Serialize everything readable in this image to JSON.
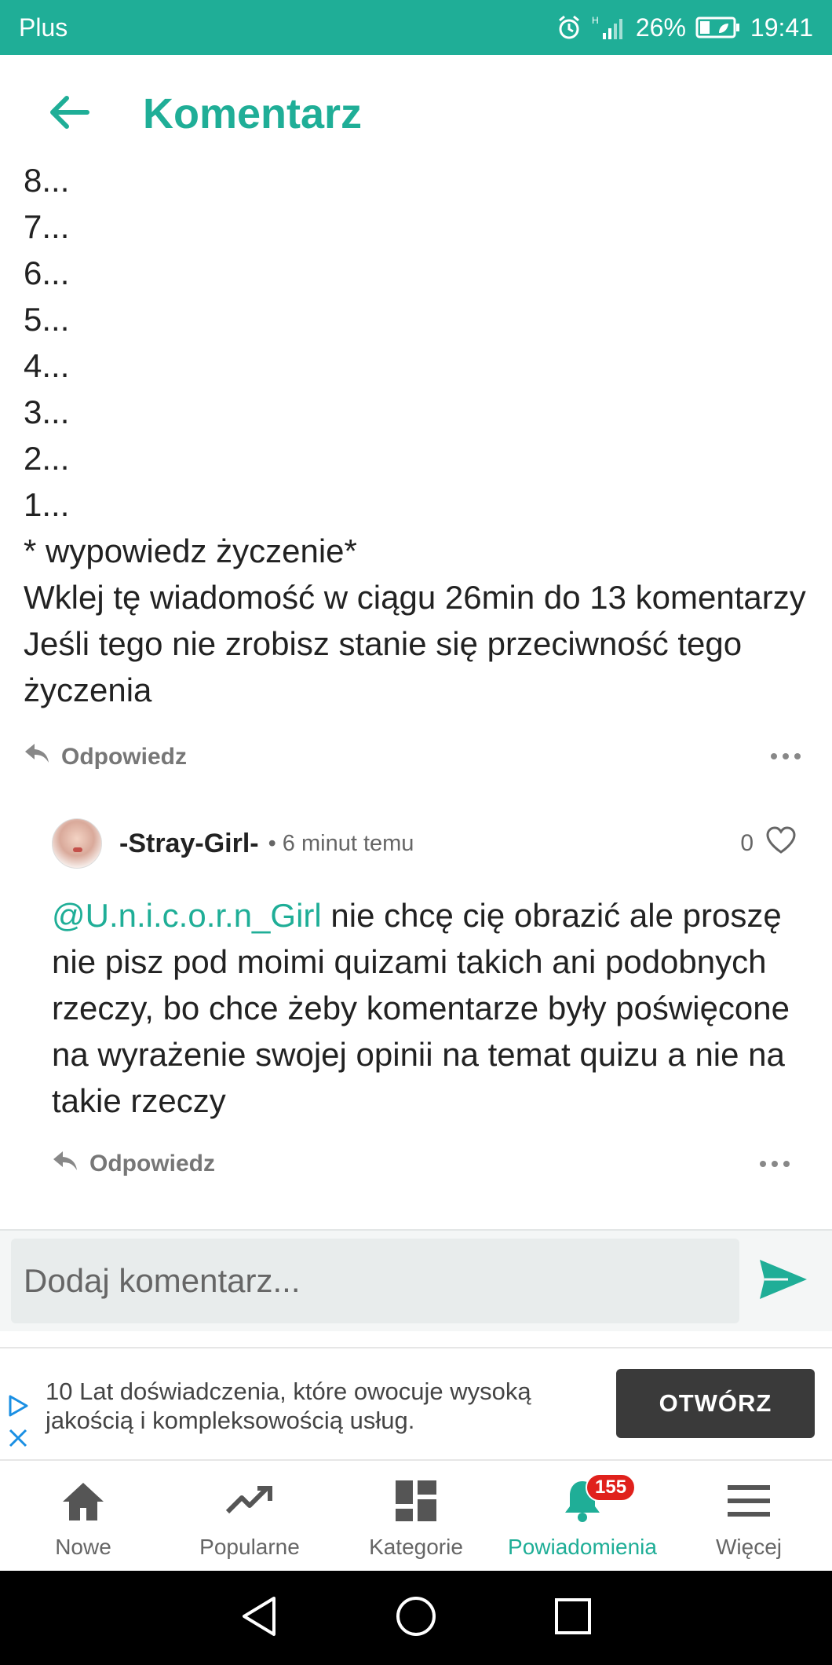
{
  "status_bar": {
    "carrier": "Plus",
    "battery": "26%",
    "time": "19:41"
  },
  "header": {
    "title": "Komentarz"
  },
  "top_comment": {
    "lines": [
      "8...",
      "7...",
      "6...",
      "5...",
      "4...",
      "3...",
      "2...",
      "1...",
      "* wypowiedz życzenie*",
      "Wklej tę wiadomość w ciągu 26min do 13 komentarzy",
      "Jeśli tego nie zrobisz stanie się przeciwność tego życzenia"
    ],
    "reply_label": "Odpowiedz"
  },
  "reply_comment": {
    "username": "-Stray-Girl-",
    "meta": "• 6 minut temu",
    "likes": "0",
    "mention": "@U.n.i.c.o.r.n_Girl",
    "text": " nie chcę cię obrazić ale proszę nie pisz pod moimi quizami takich ani podobnych rzeczy, bo chce żeby komentarze były poświęcone na wyrażenie swojej opinii na temat quizu a nie na takie rzeczy",
    "reply_label": "Odpowiedz"
  },
  "comment_input": {
    "placeholder": "Dodaj komentarz..."
  },
  "ad": {
    "text": "10 Lat doświadczenia, które owocuje wysoką jakością i kompleksowością usług.",
    "button": "OTWÓRZ"
  },
  "bottom_nav": {
    "items": [
      {
        "label": "Nowe",
        "icon": "home-icon"
      },
      {
        "label": "Popularne",
        "icon": "trending-icon"
      },
      {
        "label": "Kategorie",
        "icon": "grid-icon"
      },
      {
        "label": "Powiadomienia",
        "icon": "bell-icon",
        "badge": "155",
        "active": true
      },
      {
        "label": "Więcej",
        "icon": "menu-icon"
      }
    ]
  },
  "colors": {
    "accent": "#1fae97",
    "badge": "#e0211c",
    "ad_button": "#3a3a3a"
  }
}
